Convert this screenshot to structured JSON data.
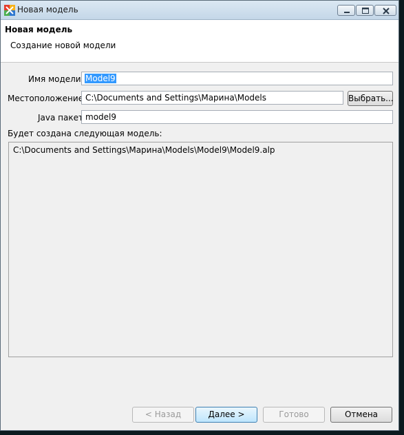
{
  "window": {
    "title": "Новая модель"
  },
  "banner": {
    "title": "Новая модель",
    "subtitle": "Создание новой модели"
  },
  "form": {
    "model_name_label": "Имя модели:",
    "model_name_value": "Model9",
    "location_label": "Местоположение:",
    "location_value": "C:\\Documents and Settings\\Марина\\Models",
    "browse_label": "Выбрать...",
    "java_package_label": "Java пакет:",
    "java_package_value": "model9",
    "result_label": "Будет создана следующая модель:",
    "result_path": "C:\\Documents and Settings\\Марина\\Models\\Model9\\Model9.alp"
  },
  "buttons": {
    "back": "< Назад",
    "next": "Далее >",
    "finish": "Готово",
    "cancel": "Отмена"
  },
  "icons": {
    "app": "anylogic-app-icon",
    "minimize": "minimize-icon",
    "maximize": "maximize-icon",
    "close": "close-icon"
  }
}
